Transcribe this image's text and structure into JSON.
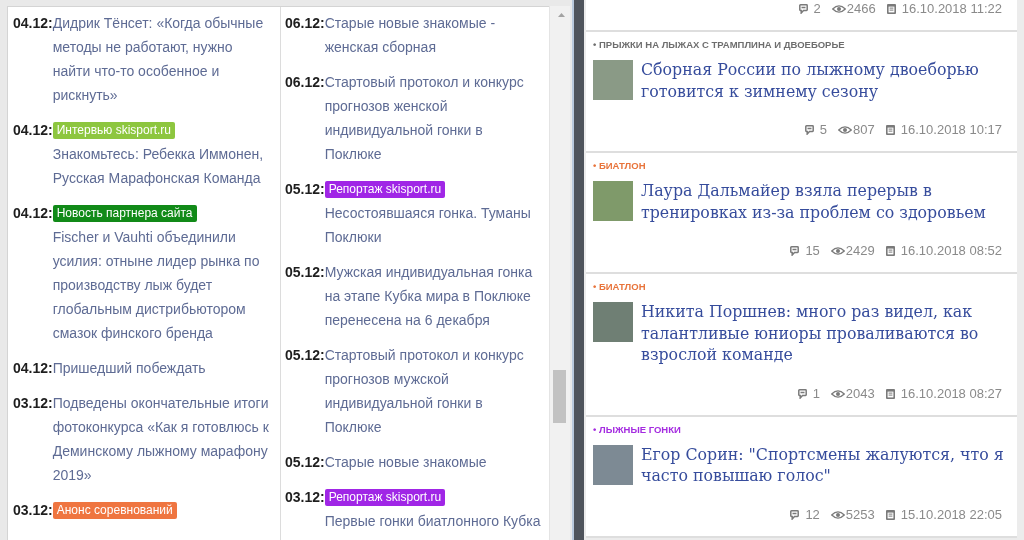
{
  "left_panel": {
    "columns": [
      {
        "items": [
          {
            "date": "04.12:",
            "title": "Дидрик Тёнсет: «Когда обычные методы не работают, нужно найти что-то особенное и рискнуть»"
          },
          {
            "date": "04.12:",
            "badge": {
              "label": "Интервью skisport.ru",
              "color": "#8dc63f"
            },
            "title": "Знакомьтесь: Ребекка Иммонен, Русская Марафонская Команда"
          },
          {
            "date": "04.12:",
            "badge": {
              "label": "Новость партнера сайта",
              "color": "#118a18"
            },
            "title": "Fischer и Vauhti объединили усилия: отныне лидер рынка по производству лыж будет глобальным дистрибьютором смазок финского бренда"
          },
          {
            "date": "04.12:",
            "title": "Пришедший побеждать"
          },
          {
            "date": "03.12:",
            "title": "Подведены окончательные итоги фотоконкурса «Как я готовлюсь к Деминскому лыжному марафону 2019»"
          },
          {
            "date": "03.12:",
            "badge": {
              "label": "Анонс соревнований",
              "color": "#ef7540"
            }
          }
        ]
      },
      {
        "items": [
          {
            "date": "06.12:",
            "title": "Старые новые знакомые - женская сборная"
          },
          {
            "date": "06.12:",
            "title": "Стартовый протокол и конкурс прогнозов женской индивидуальной гонки в Поклюке"
          },
          {
            "date": "05.12:",
            "badge": {
              "label": "Репортаж skisport.ru",
              "color": "#a026e6"
            },
            "title": "Несостоявшаяся гонка. Туманы Поклюки"
          },
          {
            "date": "05.12:",
            "title": "Мужская индивидуальная гонка на этапе Кубка мира в Поклюке перенесена на 6 декабря"
          },
          {
            "date": "05.12:",
            "title": "Стартовый протокол и конкурс прогнозов мужской индивидуальной гонки в Поклюке"
          },
          {
            "date": "05.12:",
            "title": "Старые новые знакомые"
          },
          {
            "date": "03.12:",
            "badge": {
              "label": "Репортаж skisport.ru",
              "color": "#a026e6"
            },
            "title": "Первые гонки биатлонного Кубка"
          }
        ]
      }
    ]
  },
  "right_panel": {
    "news": [
      {
        "comments": "2",
        "views": "2466",
        "date": "16.10.2018 11:22"
      },
      {
        "category": "• ПРЫЖКИ НА ЛЫЖАХ С ТРАМПЛИНА И ДВОЕБОРЬЕ",
        "color": "#6e6e6e",
        "title": "Сборная России по лыжному двоеборью готовится к зимнему сезону",
        "comments": "5",
        "views": "807",
        "date": "16.10.2018 10:17"
      },
      {
        "category": "• БИАТЛОН",
        "color": "#e8743b",
        "title": "Лаура Дальмайер взяла перерыв в тренировках из-за проблем со здоровьем",
        "comments": "15",
        "views": "2429",
        "date": "16.10.2018 08:52"
      },
      {
        "category": "• БИАТЛОН",
        "color": "#e8743b",
        "title": "Никита Поршнев: много раз видел, как талантливые юниоры проваливаются во взрослой команде",
        "comments": "1",
        "views": "2043",
        "date": "16.10.2018 08:27"
      },
      {
        "category": "• ЛЫЖНЫЕ ГОНКИ",
        "color": "#a42be0",
        "title": "Егор Сорин: \"Спортсмены жалуются, что я часто повышаю голос\"",
        "comments": "12",
        "views": "5253",
        "date": "15.10.2018 22:05"
      }
    ]
  }
}
